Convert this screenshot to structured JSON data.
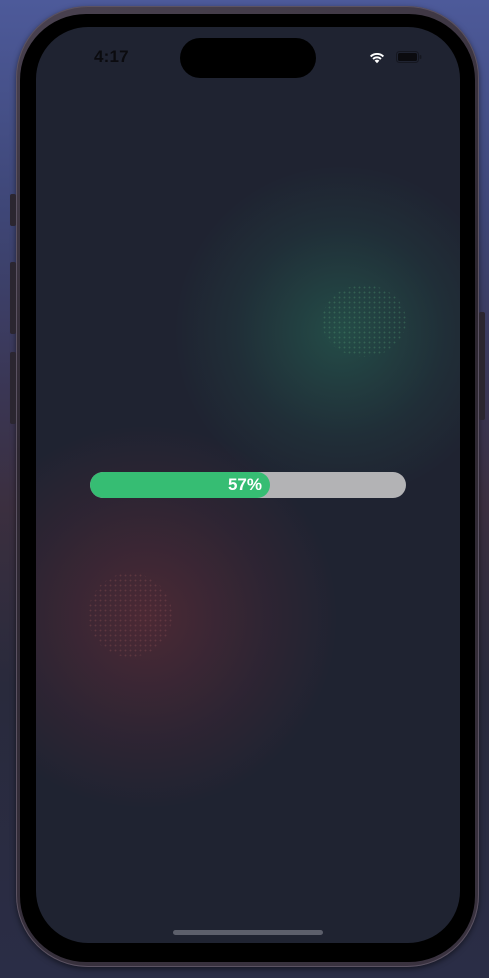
{
  "status_bar": {
    "time": "4:17",
    "wifi_icon": "wifi-icon",
    "battery_icon": "battery-icon"
  },
  "progress": {
    "value": 0.57,
    "label": "57%",
    "fill_color": "#36bd73",
    "track_color": "#b3b3b5"
  },
  "colors": {
    "screen_background": "#1f2331",
    "glow_top": "#286e5a",
    "glow_bottom": "#692d37"
  }
}
